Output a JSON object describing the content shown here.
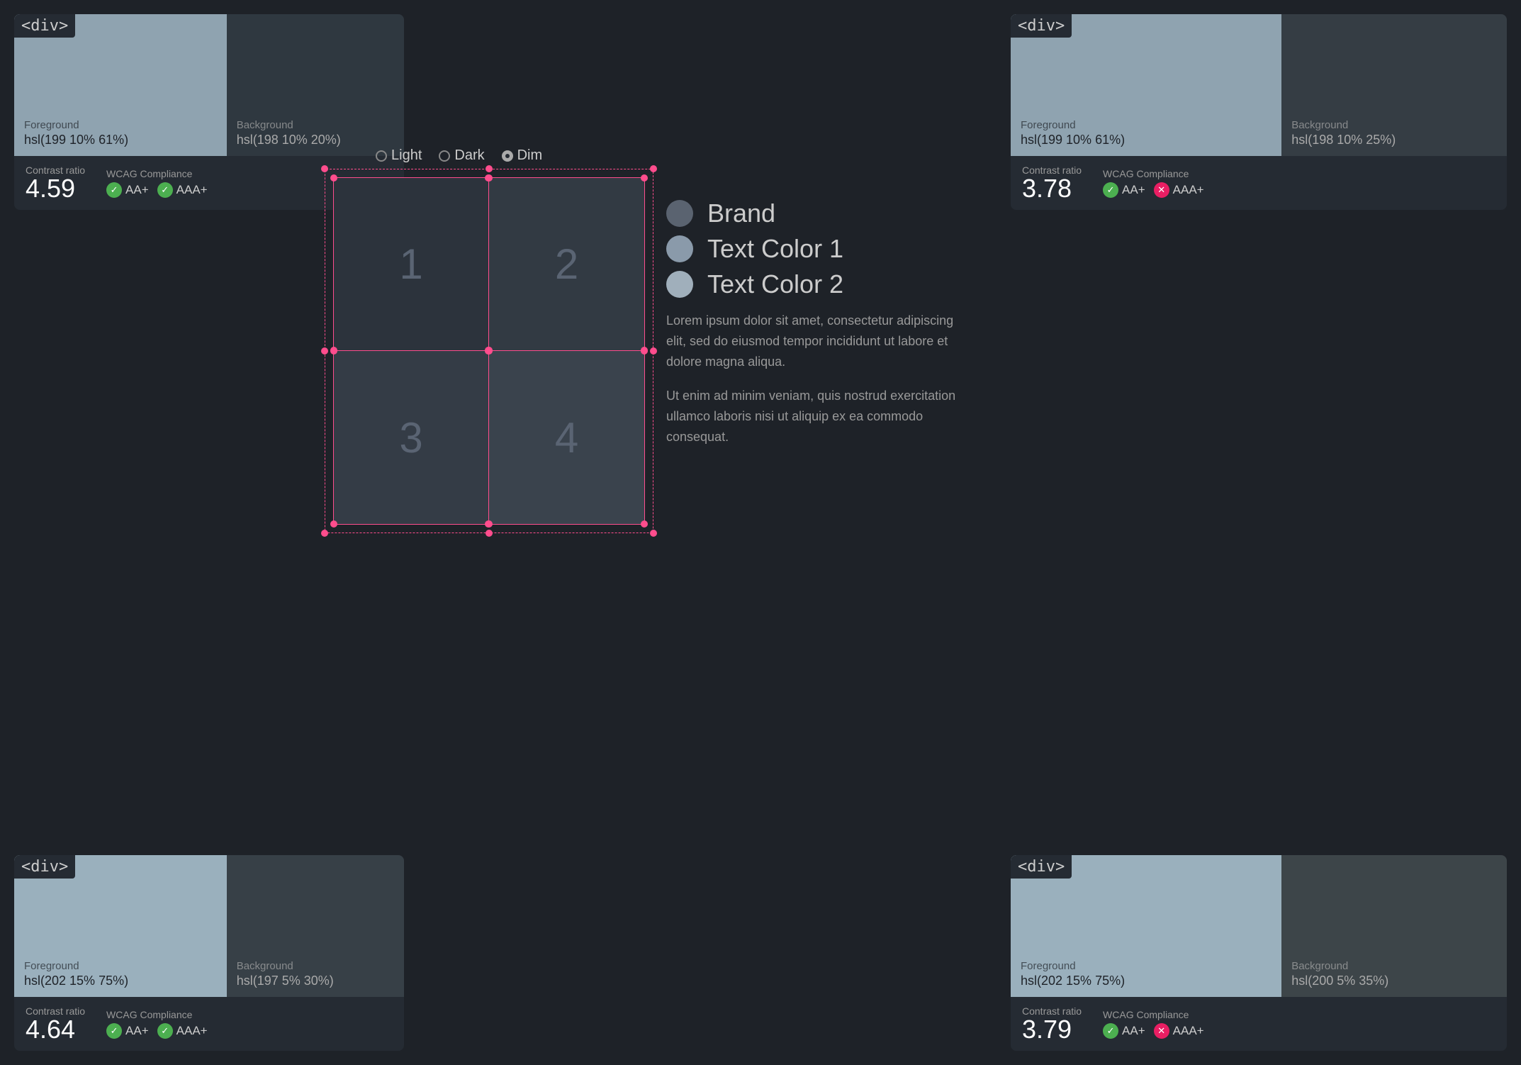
{
  "panels": {
    "tl": {
      "tag": "<div>",
      "fg_label": "Foreground",
      "fg_value": "hsl(199 10% 61%)",
      "bg_label": "Background",
      "bg_value": "hsl(198 10% 20%)",
      "contrast_label": "Contrast ratio",
      "contrast_value": "4.59",
      "wcag_label": "WCAG Compliance",
      "aa_label": "AA+",
      "aaa_label": "AAA+",
      "aa_pass": true,
      "aaa_pass": true
    },
    "tr": {
      "tag": "<div>",
      "fg_label": "Foreground",
      "fg_value": "hsl(199 10% 61%)",
      "bg_label": "Background",
      "bg_value": "hsl(198 10% 25%)",
      "contrast_label": "Contrast ratio",
      "contrast_value": "3.78",
      "wcag_label": "WCAG Compliance",
      "aa_label": "AA+",
      "aaa_label": "AAA+",
      "aa_pass": true,
      "aaa_pass": false
    },
    "bl": {
      "tag": "<div>",
      "fg_label": "Foreground",
      "fg_value": "hsl(202 15% 75%)",
      "bg_label": "Background",
      "bg_value": "hsl(197 5% 30%)",
      "contrast_label": "Contrast ratio",
      "contrast_value": "4.64",
      "wcag_label": "WCAG Compliance",
      "aa_label": "AA+",
      "aaa_label": "AAA+",
      "aa_pass": true,
      "aaa_pass": true
    },
    "br": {
      "tag": "<div>",
      "fg_label": "Foreground",
      "fg_value": "hsl(202 15% 75%)",
      "bg_label": "Background",
      "bg_value": "hsl(200 5% 35%)",
      "contrast_label": "Contrast ratio",
      "contrast_value": "3.79",
      "wcag_label": "WCAG Compliance",
      "aa_label": "AA+",
      "aaa_label": "AAA+",
      "aa_pass": true,
      "aaa_pass": false
    }
  },
  "theme_selector": {
    "options": [
      "Light",
      "Dark",
      "Dim"
    ],
    "selected": "Dim"
  },
  "grid": {
    "cells": [
      "1",
      "2",
      "3",
      "4"
    ]
  },
  "legend": {
    "items": [
      {
        "label": "Brand",
        "color": "#5a6370"
      },
      {
        "label": "Text Color 1",
        "color": "#8a9aaa"
      },
      {
        "label": "Text Color 2",
        "color": "#a0afbb"
      }
    ],
    "lorem1": "Lorem ipsum dolor sit amet, consectetur adipiscing elit, sed do eiusmod tempor incididunt ut labore et dolore magna aliqua.",
    "lorem2": "Ut enim ad minim veniam, quis nostrud exercitation ullamco laboris nisi ut aliquip ex ea commodo consequat."
  }
}
